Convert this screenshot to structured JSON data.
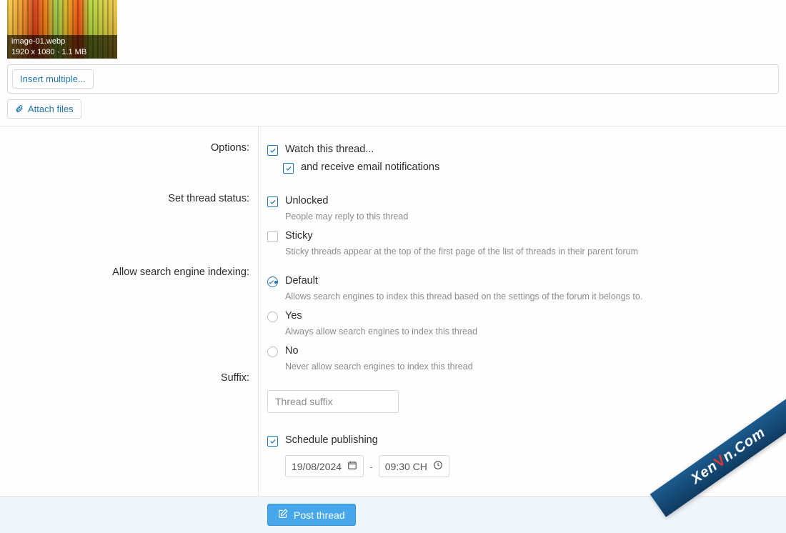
{
  "attachment": {
    "filename": "image-01.webp",
    "dimensions_size": "1920 x 1080 · 1.1 MB"
  },
  "buttons": {
    "insert_multiple": "Insert multiple...",
    "attach_files": "Attach files",
    "post_thread": "Post thread"
  },
  "labels": {
    "options": "Options:",
    "thread_status": "Set thread status:",
    "indexing": "Allow search engine indexing:",
    "suffix": "Suffix:"
  },
  "options": {
    "watch": "Watch this thread...",
    "emails": "and receive email notifications"
  },
  "status": {
    "unlocked": {
      "title": "Unlocked",
      "hint": "People may reply to this thread"
    },
    "sticky": {
      "title": "Sticky",
      "hint": "Sticky threads appear at the top of the first page of the list of threads in their parent forum"
    }
  },
  "indexing": {
    "default": {
      "title": "Default",
      "hint": "Allows search engines to index this thread based on the settings of the forum it belongs to."
    },
    "yes": {
      "title": "Yes",
      "hint": "Always allow search engines to index this thread"
    },
    "no": {
      "title": "No",
      "hint": "Never allow search engines to index this thread"
    }
  },
  "suffix": {
    "placeholder": "Thread suffix",
    "value": ""
  },
  "schedule": {
    "label": "Schedule publishing",
    "date": "19/08/2024",
    "time": "09:30 CH"
  },
  "date_sep": "-",
  "watermark": {
    "pre": "Xen",
    "mid": "V",
    "post": "n.Com"
  }
}
